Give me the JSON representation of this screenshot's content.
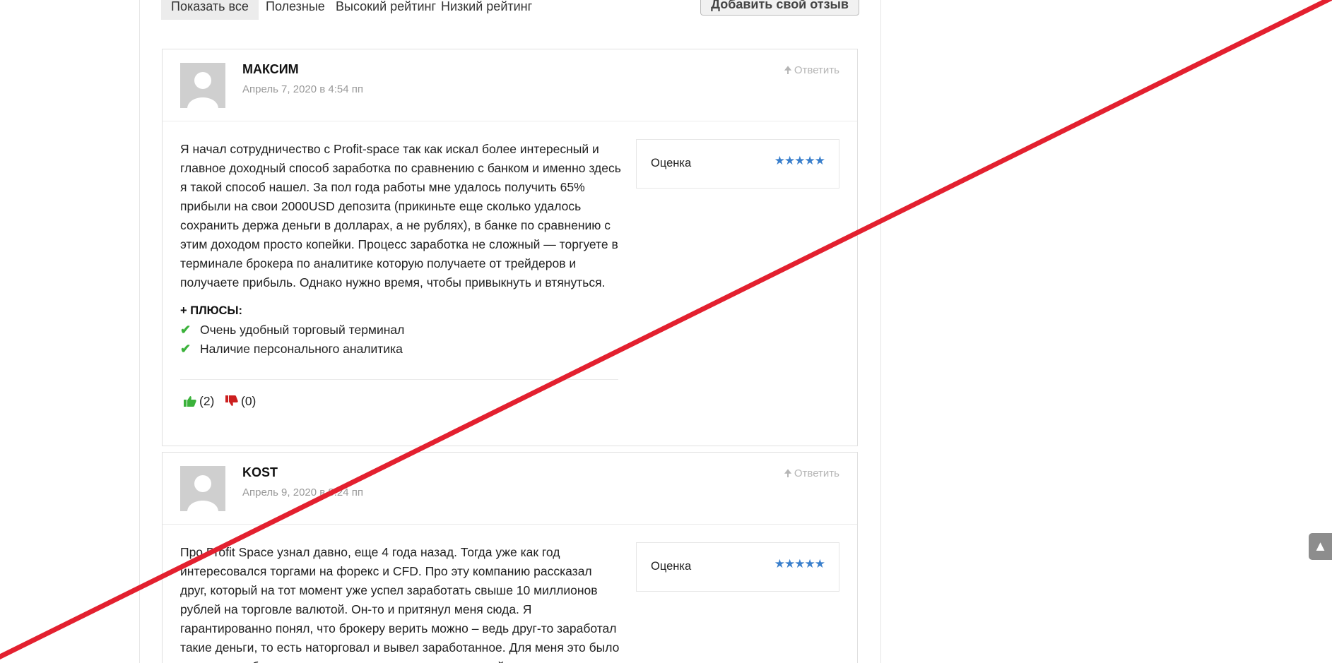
{
  "filters": {
    "tabs": [
      {
        "label": "Показать все",
        "active": true
      },
      {
        "label": "Полезные",
        "active": false
      },
      {
        "label": "Высокий рейтинг",
        "active": false
      },
      {
        "label": "Низкий рейтинг",
        "active": false
      }
    ],
    "add_review_label": "Добавить свой отзыв"
  },
  "reviews": [
    {
      "author": "МАКСИМ",
      "date": "Апрель 7, 2020 в 4:54 пп",
      "reply_label": "Ответить",
      "rating_label": "Оценка",
      "rating": 5,
      "text": "Я начал сотрудничество с Profit-space так как искал более интересный и главное доходный способ заработка по сравнению с банком и именно здесь я такой способ нашел. За пол года работы мне удалось получить 65% прибыли на свои 2000USD депозита (прикиньте еще сколько удалось сохранить держа деньги в долларах, а не рублях), в банке по сравнению с этим доходом просто копейки. Процесс заработка не сложный — торгуете в терминале брокера по аналитике которую получаете от трейдеров и получаете прибыль. Однако нужно время, чтобы привыкнуть и втянуться.",
      "pros_title": "+ ПЛЮСЫ:",
      "pros": [
        "Очень удобный торговый терминал",
        "Наличие персонального аналитика"
      ],
      "likes": "(2)",
      "dislikes": "(0)"
    },
    {
      "author": "KOST",
      "date": "Апрель 9, 2020 в 8:24 пп",
      "reply_label": "Ответить",
      "rating_label": "Оценка",
      "rating": 5,
      "text": "Про Profit Space узнал давно, еще 4 года назад. Тогда уже как год интересовался торгами на форекс и CFD. Про эту компанию рассказал друг, который на тот момент уже успел заработать свыше 10 миллионов рублей на торговле валютой. Он-то и притянул меня сюда. Я гарантированно понял, что брокеру верить можно – ведь друг-то заработал такие деньги, то есть наторговал и вывел заработанное. Для меня это было важным, чтобы компания выводила деньги, иначе какой смысл"
    }
  ],
  "icons": {
    "reply": "arrow-up-icon",
    "check": "check-icon",
    "like": "thumbs-up-icon",
    "dislike": "thumbs-down-icon",
    "scroll_top": "chevron-up-icon",
    "avatar": "default-avatar-icon"
  },
  "colors": {
    "stars": "#3a7fcc",
    "check": "#3bb23b",
    "like": "#3bb23b",
    "dislike": "#cc1f1f",
    "strike_line": "#e3202f"
  }
}
